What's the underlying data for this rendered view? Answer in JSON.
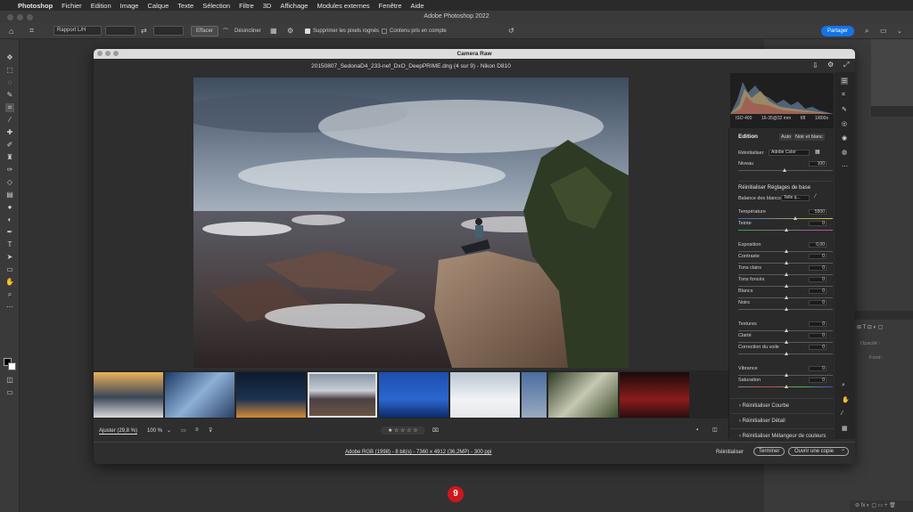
{
  "menubar": {
    "apple": "",
    "app": "Photoshop",
    "items": [
      "Fichier",
      "Edition",
      "Image",
      "Calque",
      "Texte",
      "Sélection",
      "Filtre",
      "3D",
      "Affichage",
      "Modules externes",
      "Fenêtre",
      "Aide"
    ]
  },
  "window": {
    "title": "Adobe Photoshop 2022"
  },
  "options": {
    "ratio": "Rapport L/H",
    "clear": "Effacer",
    "straighten": "Désincliner",
    "delete_cropped": "Supprimer les pixels rognés",
    "content_aware": "Contenu pris en compte",
    "share": "Partager"
  },
  "camera_raw": {
    "title": "Camera Raw",
    "file": "20150807_SedonaD4_233-nef_DxO_DeepPRIME.dng (4 sur 9)  -  Nikon D810",
    "zoom_fit": "Ajuster (29,8 %)",
    "zoom": "100 %",
    "stars": "★ ☆ ☆ ☆ ☆",
    "workflow": "Adobe RGB (1998) - 8 bit(s) - 7360 x 4912 (36,2MP) - 300 ppi",
    "reset": "Réinitialiser",
    "done": "Terminer",
    "open": "Ouvrir une copie",
    "exif": {
      "iso": "ISO 400",
      "focal": "16-35@32 mm",
      "aperture": "f/8",
      "shutter": "1/800s"
    },
    "edit": {
      "title": "Edition",
      "auto": "Auto",
      "bw": "Noir et blanc",
      "profile_label": "Réinitialiser",
      "profile": "Adobe Color",
      "amount_label": "Niveau",
      "amount": "100",
      "basic_title": "Réinitialiser Réglages de base",
      "wb_label": "Balance des blancs",
      "wb": "Telle q...",
      "sliders": [
        {
          "label": "Température",
          "value": "5500",
          "pos": 0.6
        },
        {
          "label": "Teinte",
          "value": "0",
          "pos": 0.5
        },
        {
          "label": "Exposition",
          "value": "0,00",
          "pos": 0.5
        },
        {
          "label": "Contraste",
          "value": "0",
          "pos": 0.5
        },
        {
          "label": "Tons clairs",
          "value": "0",
          "pos": 0.5
        },
        {
          "label": "Tons foncés",
          "value": "0",
          "pos": 0.5
        },
        {
          "label": "Blancs",
          "value": "0",
          "pos": 0.5
        },
        {
          "label": "Noirs",
          "value": "0",
          "pos": 0.5
        },
        {
          "label": "Textures",
          "value": "0",
          "pos": 0.5
        },
        {
          "label": "Clarté",
          "value": "0",
          "pos": 0.5
        },
        {
          "label": "Correction du voile",
          "value": "0",
          "pos": 0.5
        },
        {
          "label": "Vibrance",
          "value": "0",
          "pos": 0.5
        },
        {
          "label": "Saturation",
          "value": "0",
          "pos": 0.5
        }
      ],
      "sections": [
        "Réinitialiser Courbe",
        "Réinitialiser Détail",
        "Réinitialiser Mélangeur de couleurs"
      ]
    }
  },
  "right_panel": {
    "opacity": "Opacité :",
    "fill": "Fond :"
  },
  "badge": "9"
}
